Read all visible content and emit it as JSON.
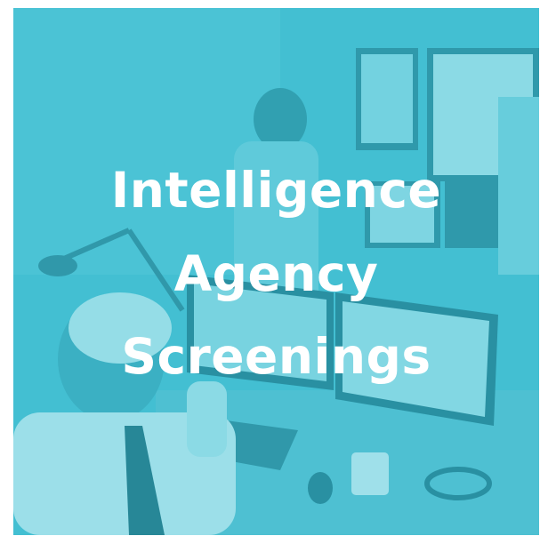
{
  "tile": {
    "title_line_1": "Intelligence",
    "title_line_2": "Agency",
    "title_line_3": "Screenings",
    "overlay_color": "#3fb8cc",
    "text_color": "#ffffff"
  }
}
